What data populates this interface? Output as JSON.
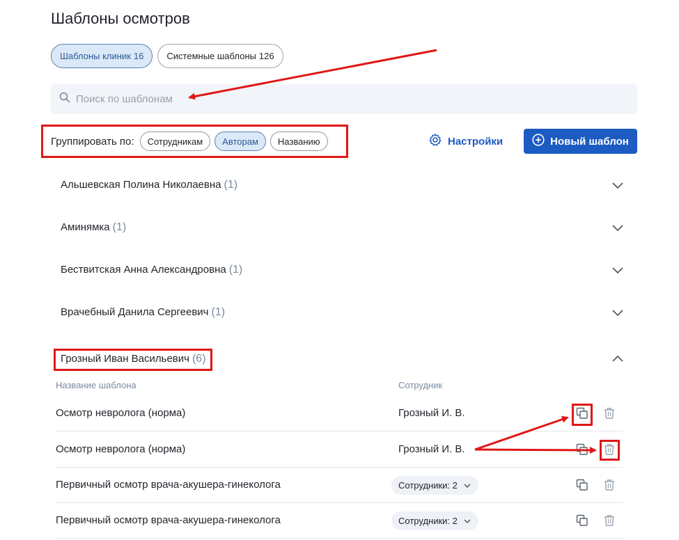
{
  "page": {
    "title": "Шаблоны осмотров"
  },
  "tabs": [
    {
      "label": "Шаблоны клиник",
      "count": "16"
    },
    {
      "label": "Системные шаблоны",
      "count": "126"
    }
  ],
  "search": {
    "placeholder": "Поиск по шаблонам",
    "value": ""
  },
  "group_by": {
    "label": "Группировать по:",
    "options": [
      "Сотрудникам",
      "Авторам",
      "Названию"
    ],
    "selected": "Авторам"
  },
  "toolbar": {
    "settings_label": "Настройки",
    "new_template_label": "Новый шаблон"
  },
  "groups": [
    {
      "name": "Альшевская Полина Николаевна",
      "count": "(1)"
    },
    {
      "name": "Аминямка",
      "count": "(1)"
    },
    {
      "name": "Бествитская Анна Александровна",
      "count": "(1)"
    },
    {
      "name": "Врачебный Данила Сергеевич",
      "count": "(1)"
    },
    {
      "name": "Грозный Иван Васильевич",
      "count": "(6)"
    }
  ],
  "table": {
    "headers": {
      "name": "Название шаблона",
      "employee": "Сотрудник"
    },
    "rows": [
      {
        "name": "Осмотр невролога (норма)",
        "employee": "Грозный И. В."
      },
      {
        "name": "Осмотр невролога (норма)",
        "employee": "Грозный И. В."
      },
      {
        "name": "Первичный осмотр врача-акушера-гинеколога",
        "employee": "Сотрудники: 2"
      },
      {
        "name": "Первичный осмотр врача-акушера-гинеколога",
        "employee": "Сотрудники: 2"
      }
    ]
  },
  "colors": {
    "accent": "#1c5bc2",
    "annotation": "#e01717",
    "chip_active_bg": "#dbe8f8"
  }
}
